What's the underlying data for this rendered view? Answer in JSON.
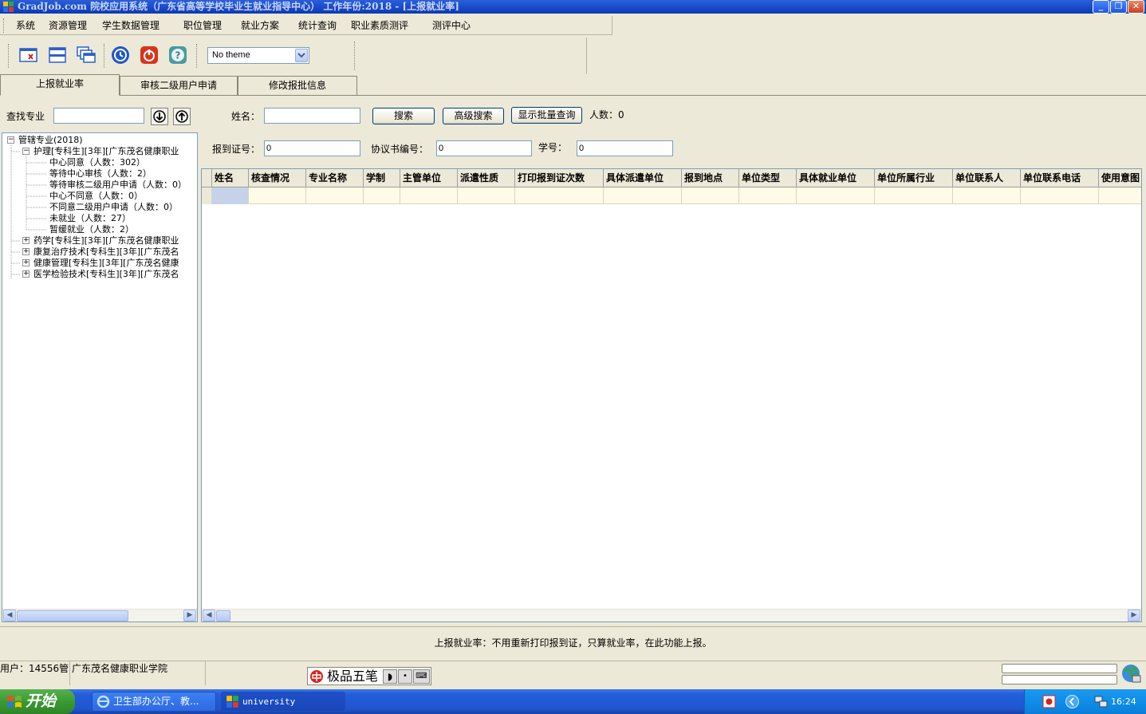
{
  "window": {
    "title": "GradJob.com 院校应用系统（广东省高等学校毕业生就业指导中心） 工作年份:2018 - [上报就业率]",
    "controls": {
      "minimize": "_",
      "restore": "❐",
      "close": "✕"
    }
  },
  "menu": [
    "系统",
    "资源管理",
    "学生数据管理",
    "职位管理",
    "就业方案",
    "统计查询",
    "职业素质测评",
    "测评中心"
  ],
  "toolbar": {
    "theme_value": "No theme"
  },
  "tabs": [
    {
      "label": "上报就业率",
      "active": true
    },
    {
      "label": "审核二级用户申请",
      "active": false
    },
    {
      "label": "修改报批信息",
      "active": false
    }
  ],
  "search": {
    "find_major_label": "查找专业",
    "find_major_value": "",
    "name_label": "姓名：",
    "name_value": "",
    "search_button": "搜索",
    "advanced_button": "高级搜索",
    "batch_button": "显示批量查询",
    "count_label": "人数：0",
    "report_no_label": "报到证号：",
    "report_no_value": "0",
    "agreement_label": "协议书编号：",
    "agreement_value": "0",
    "student_id_label": "学号：",
    "student_id_value": "0"
  },
  "tree": {
    "root": "管辖专业(2018)",
    "expanded": {
      "label": "护理[专科生][3年][广东茂名健康职业",
      "children": [
        "中心同意（人数：302）",
        "等待中心审核（人数：2）",
        "等待审核二级用户申请（人数：0）",
        "中心不同意（人数：0）",
        "不同意二级用户申请（人数：0）",
        "未就业（人数：27）",
        "暂缓就业（人数：2）"
      ]
    },
    "collapsed": [
      "药学[专科生][3年][广东茂名健康职业",
      "康复治疗技术[专科生][3年][广东茂名",
      "健康管理[专科生][3年][广东茂名健康",
      "医学检验技术[专科生][3年][广东茂名"
    ]
  },
  "grid": {
    "columns": [
      "姓名",
      "核查情况",
      "专业名称",
      "学制",
      "主管单位",
      "派遣性质",
      "打印报到证次数",
      "具体派遣单位",
      "报到地点",
      "单位类型",
      "具体就业单位",
      "单位所属行业",
      "单位联系人",
      "单位联系电话",
      "使用意图"
    ]
  },
  "notice": "上报就业率：不用重新打印报到证，只算就业率，在此功能上报。",
  "status": {
    "user": "用户：14556管 广东茂名健康职业学院",
    "ime": "极品五笔"
  },
  "taskbar": {
    "start": "开始",
    "items": [
      "卫生部办公厅、教...",
      "university"
    ],
    "clock": "16:24"
  }
}
